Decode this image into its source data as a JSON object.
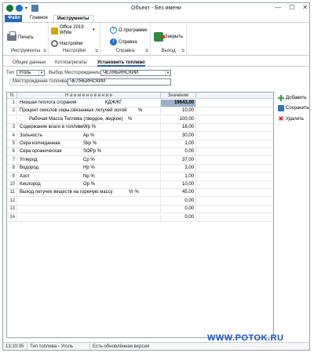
{
  "window": {
    "title": "Объект - Без имени"
  },
  "ribbon_tabs": [
    "Файл",
    "Главное",
    "Инструменты"
  ],
  "ribbon": {
    "groups": [
      {
        "label": "Инструменты",
        "buttons": [
          "Печать"
        ]
      },
      {
        "label": "Настройки",
        "buttons": [
          "Office 2019",
          "White",
          "Настройки"
        ]
      },
      {
        "label": "Справка",
        "buttons": [
          "О программе",
          "Справка"
        ]
      },
      {
        "label": "Выход",
        "buttons": [
          "Закрыть"
        ]
      }
    ]
  },
  "page_tabs": [
    "Общие данные",
    "Котлоагрегаты",
    "Установить топливо"
  ],
  "form": {
    "type_label": "Тип",
    "type_value": "Уголь",
    "deposit_choice_label": "Выбор Месторождения",
    "deposit_choice_value": "ЧЕЛЯБИНСКИЙ",
    "deposit_label": "Месторождение топлива",
    "deposit_value": "ЧЕЛЯБИНСКИЙ"
  },
  "grid": {
    "columns": [
      "N",
      "Н а и м е н о в а н и е",
      "Значение"
    ],
    "rows": [
      {
        "no": "1",
        "name": "Низшая теплота сгорания",
        "unit": "КДЖ/КГ",
        "value": "19643,00",
        "selected": true
      },
      {
        "no": "2",
        "name": "Процент окислов серы,связанных летучей золой",
        "unit": "%",
        "value": "10,00"
      },
      {
        "no": "",
        "name": "Рабочая Масса Топлива (твердое, жидкое)",
        "unit": "%",
        "value": "100,00"
      },
      {
        "no": "3",
        "name": "Содержание влаги в топливе",
        "unit": "Wp  %",
        "value": "18,00"
      },
      {
        "no": "4",
        "name": "Зольность",
        "unit": "Ap  %",
        "value": "30,00"
      },
      {
        "no": "5",
        "name": "Сера колчеданная",
        "unit": "Skp  %",
        "value": "1,00"
      },
      {
        "no": "6",
        "name": "Сера органическая",
        "unit": "SOPp  %",
        "value": "0,00"
      },
      {
        "no": "7",
        "name": "Углерод",
        "unit": "Cp  %",
        "value": "37,00"
      },
      {
        "no": "8",
        "name": "Водород",
        "unit": "Hp  %",
        "value": "3,00"
      },
      {
        "no": "9",
        "name": "Азот",
        "unit": "Np  %",
        "value": "1,00"
      },
      {
        "no": "10",
        "name": "Кислород",
        "unit": "Op  %",
        "value": "10,00"
      },
      {
        "no": "11",
        "name": "Выход летучих веществ на горючую массу",
        "unit": "Vr   %",
        "value": "45,00"
      },
      {
        "no": "12",
        "name": "",
        "unit": "",
        "value": "0,00"
      },
      {
        "no": "13",
        "name": "",
        "unit": "",
        "value": "0,00"
      },
      {
        "no": "14",
        "name": "",
        "unit": "",
        "value": "0,00"
      }
    ]
  },
  "actions": {
    "add": "Добавить",
    "save": "Сохранить",
    "delete": "Удалить"
  },
  "watermark": "WWW.POTOK.RU",
  "status": {
    "time": "13:20:35",
    "fuel": "Тип топлива - Уголь",
    "version": "Есть обновлённая версия"
  }
}
